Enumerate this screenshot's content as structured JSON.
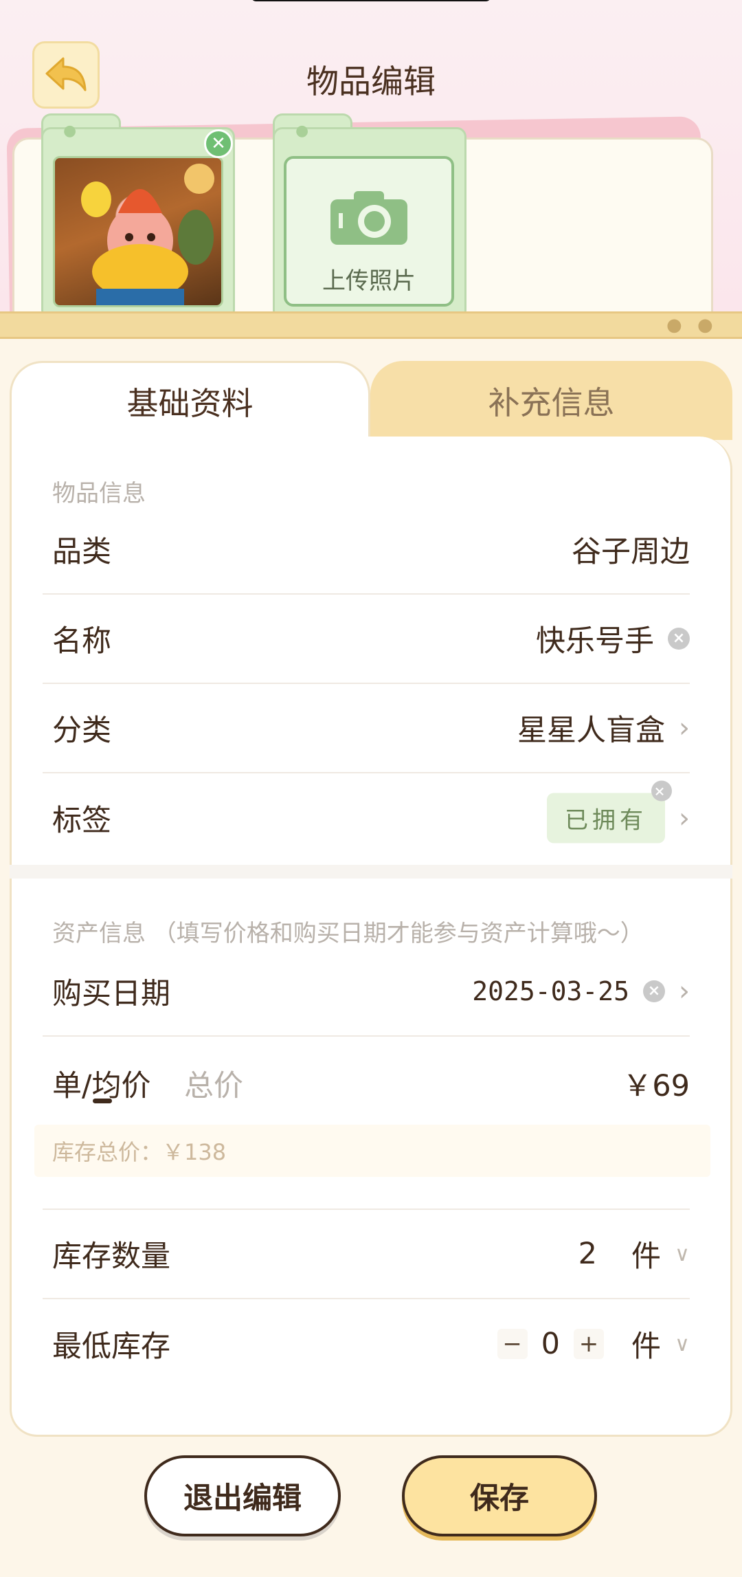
{
  "header": {
    "title": "物品编辑",
    "back_icon": "back-arrow-icon"
  },
  "photos": {
    "upload_label": "上传照片",
    "icons": [
      "close-icon",
      "camera-icon",
      "paw-icon"
    ]
  },
  "tabs": [
    {
      "label": "基础资料",
      "active": true
    },
    {
      "label": "补充信息",
      "active": false
    }
  ],
  "item_info": {
    "section_title": "物品信息",
    "category": {
      "label": "品类",
      "value": "谷子周边"
    },
    "name": {
      "label": "名称",
      "value": "快乐号手"
    },
    "classification": {
      "label": "分类",
      "value": "星星人盲盒"
    },
    "tag": {
      "label": "标签",
      "value": "已拥有"
    }
  },
  "asset_info": {
    "section_title": "资产信息 （填写价格和购买日期才能参与资产计算哦～）",
    "purchase_date": {
      "label": "购买日期",
      "value": "2025-03-25"
    },
    "price": {
      "unit_tab": "单/均价",
      "total_tab": "总价",
      "value": "￥69",
      "stock_total": "库存总价：￥138"
    },
    "stock_qty": {
      "label": "库存数量",
      "value": "2",
      "unit": "件"
    },
    "min_stock": {
      "label": "最低库存",
      "value": "0",
      "unit": "件",
      "minus": "−",
      "plus": "+"
    }
  },
  "footer": {
    "exit_label": "退出编辑",
    "save_label": "保存"
  },
  "colors": {
    "accent": "#fde3a0",
    "green": "#d6ecc9",
    "text": "#3f2a1c"
  }
}
